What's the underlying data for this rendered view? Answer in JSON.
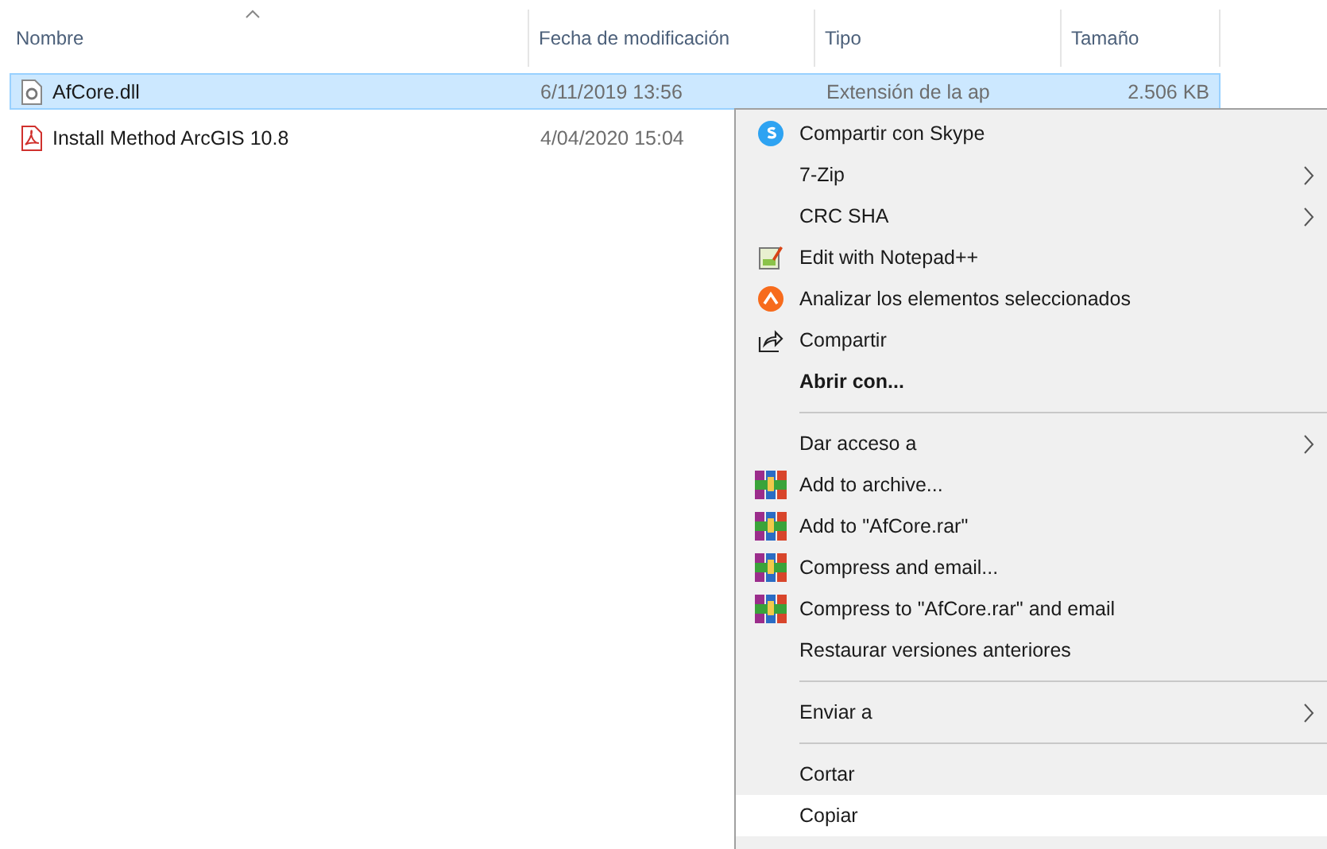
{
  "columns": [
    {
      "label": "Nombre",
      "sorted": true
    },
    {
      "label": "Fecha de modificación",
      "sorted": false
    },
    {
      "label": "Tipo",
      "sorted": false
    },
    {
      "label": "Tamaño",
      "sorted": false
    }
  ],
  "files": [
    {
      "kind": "dll",
      "name": "AfCore.dll",
      "date": "6/11/2019 13:56",
      "type": "Extensión de la ap",
      "size": "2.506 KB",
      "selected": true
    },
    {
      "kind": "pdf",
      "name": "Install Method ArcGIS 10.8",
      "date": "4/04/2020 15:04",
      "selected": false
    }
  ],
  "context_menu": {
    "items": [
      {
        "kind": "item",
        "label": "Compartir con Skype",
        "submenu": false,
        "bold": false,
        "selected": false
      },
      {
        "kind": "item",
        "label": "7-Zip",
        "submenu": true,
        "bold": false,
        "selected": false
      },
      {
        "kind": "item",
        "label": "CRC SHA",
        "submenu": true,
        "bold": false,
        "selected": false
      },
      {
        "kind": "item",
        "label": "Edit with Notepad++",
        "submenu": false,
        "bold": false,
        "selected": false
      },
      {
        "kind": "item",
        "label": "Analizar los elementos seleccionados",
        "submenu": false,
        "bold": false,
        "selected": false
      },
      {
        "kind": "item",
        "label": "Compartir",
        "submenu": false,
        "bold": false,
        "selected": false
      },
      {
        "kind": "item",
        "label": "Abrir con...",
        "submenu": false,
        "bold": true,
        "selected": false
      },
      {
        "kind": "separator"
      },
      {
        "kind": "item",
        "label": "Dar acceso a",
        "submenu": true,
        "bold": false,
        "selected": false
      },
      {
        "kind": "item",
        "label": "Add to archive...",
        "submenu": false,
        "bold": false,
        "selected": false
      },
      {
        "kind": "item",
        "label": "Add to \"AfCore.rar\"",
        "submenu": false,
        "bold": false,
        "selected": false
      },
      {
        "kind": "item",
        "label": "Compress and email...",
        "submenu": false,
        "bold": false,
        "selected": false
      },
      {
        "kind": "item",
        "label": "Compress to \"AfCore.rar\" and email",
        "submenu": false,
        "bold": false,
        "selected": false
      },
      {
        "kind": "item",
        "label": "Restaurar versiones anteriores",
        "submenu": false,
        "bold": false,
        "selected": false
      },
      {
        "kind": "separator"
      },
      {
        "kind": "item",
        "label": "Enviar a",
        "submenu": true,
        "bold": false,
        "selected": false
      },
      {
        "kind": "separator"
      },
      {
        "kind": "item",
        "label": "Cortar",
        "submenu": false,
        "bold": false,
        "selected": false
      },
      {
        "kind": "item",
        "label": "Copiar",
        "submenu": false,
        "bold": false,
        "selected": true
      }
    ]
  }
}
